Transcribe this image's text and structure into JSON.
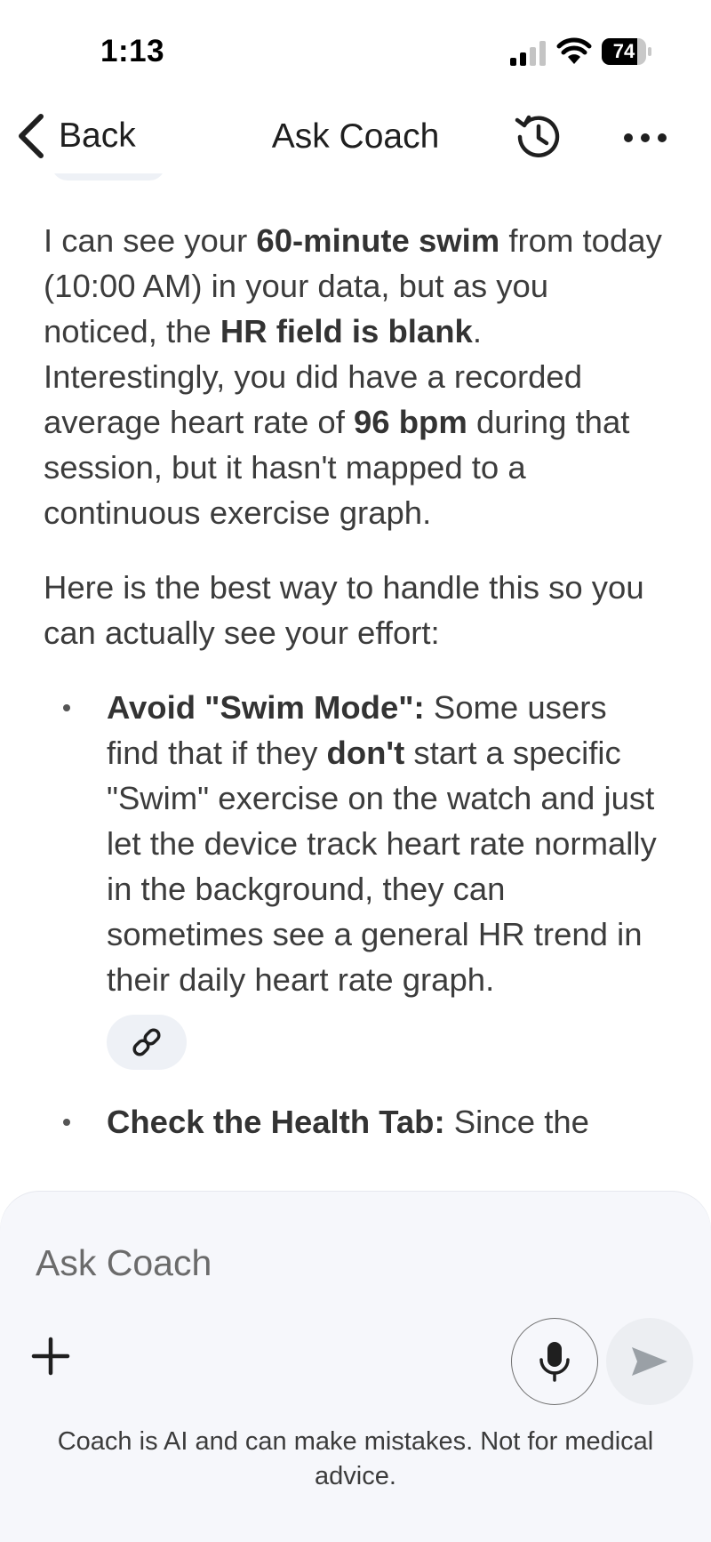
{
  "status_bar": {
    "time": "1:13",
    "battery_level": "74",
    "icons": [
      "signal-icon",
      "wifi-icon",
      "battery-icon"
    ]
  },
  "nav": {
    "back_label": "Back",
    "title": "Ask Coach",
    "icons": [
      "chevron-left-icon",
      "history-icon",
      "more-icon"
    ]
  },
  "message": {
    "p1": {
      "t1": "I can see your ",
      "b1": "60-minute swim",
      "t2": " from today (10:00 AM) in your data, but as you noticed, the ",
      "b2": "HR field is blank",
      "t3": ". Interestingly, you did have a recorded average heart rate of ",
      "b3": "96 bpm",
      "t4": " during that session, but it hasn't mapped to a continuous exercise graph."
    },
    "p2": "Here is the best way to handle this so you can actually see your effort:",
    "bullets": [
      {
        "title": "Avoid \"Swim Mode\":",
        "t1": " Some users find that if they ",
        "b1": "don't",
        "t2": " start a specific \"Swim\" exercise on the watch and just let the device track heart rate normally in the background, they can sometimes see a general HR trend in their daily heart rate graph.",
        "icon": "link-icon"
      },
      {
        "title": "Check the Health Tab:",
        "t1": " Since the"
      }
    ]
  },
  "composer": {
    "placeholder": "Ask Coach",
    "disclaimer": "Coach is AI and can make mistakes. Not for medical advice.",
    "icons": [
      "plus-icon",
      "mic-icon",
      "send-icon"
    ]
  },
  "colors": {
    "text": "#3c3c3c",
    "composer_bg": "#f6f7fb",
    "chip_bg": "#eef1f6",
    "send_icon": "#9aa0a6"
  }
}
